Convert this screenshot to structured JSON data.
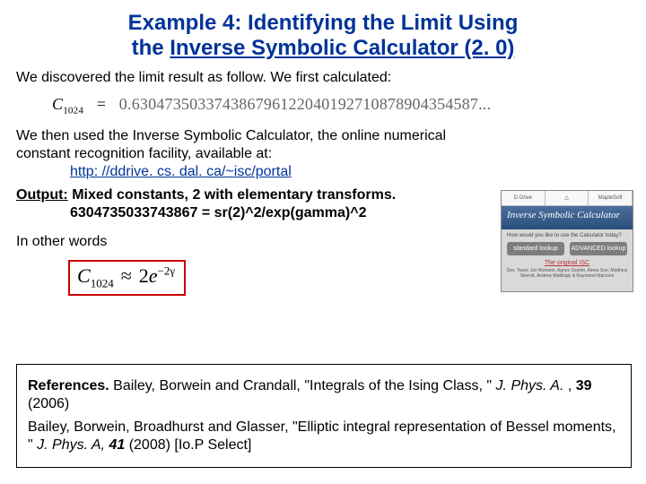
{
  "title_line1": "Example 4: Identifying the Limit Using",
  "title_line2_a": "the ",
  "title_line2_u": "Inverse Symbolic Calculator (2. 0)",
  "p1": "We discovered the limit result as follow. We first calculated:",
  "formula1": {
    "lhs_sym": "C",
    "lhs_sub": "1024",
    "eq": "=",
    "rhs": "0.630473503374386796122040192710878904354587..."
  },
  "p2a": "We then used the Inverse Symbolic Calculator, the online numerical constant recognition facility, available at:",
  "link": "http: //ddrive. cs. dal. ca/~isc/portal",
  "output_label": "Output:",
  "output_line1": " Mixed constants, 2 with elementary transforms.",
  "output_line2": "6304735033743867 = sr(2)^2/exp(gamma)^2",
  "p3": "In other words",
  "formula2": {
    "lhs_sym": "C",
    "lhs_sub": "1024",
    "approx": "≈",
    "two": "2",
    "e": "e",
    "exp": "−2γ"
  },
  "isc": {
    "banner": "Inverse Symbolic Calculator",
    "q": "How would you like to use the Calculator today?",
    "btn1": "standard lookup",
    "btn2": "ADVANCED lookup",
    "orig": "The original ISC",
    "credit": "Dev. Team: Jon Borwein, Agnes Szanto, Alena Soo, Matthew Skerritt, Andrew Mattingly & Raymond Manzoni"
  },
  "refs": {
    "r1": {
      "lead": "References.",
      "body_a": " Bailey, Borwein and Crandall, \"Integrals of the Ising Class, \" ",
      "journal": "J. Phys. A.",
      "body_b": " , ",
      "vol": "39",
      "body_c": " (2006)"
    },
    "r2": {
      "body_a": "Bailey, Borwein, Broadhurst and Glasser, \"Elliptic integral representation of Bessel moments, \" ",
      "journal": "J. Phys. A,",
      "vol": " 41",
      "body_c": " (2008) [Io.P Select]"
    }
  }
}
